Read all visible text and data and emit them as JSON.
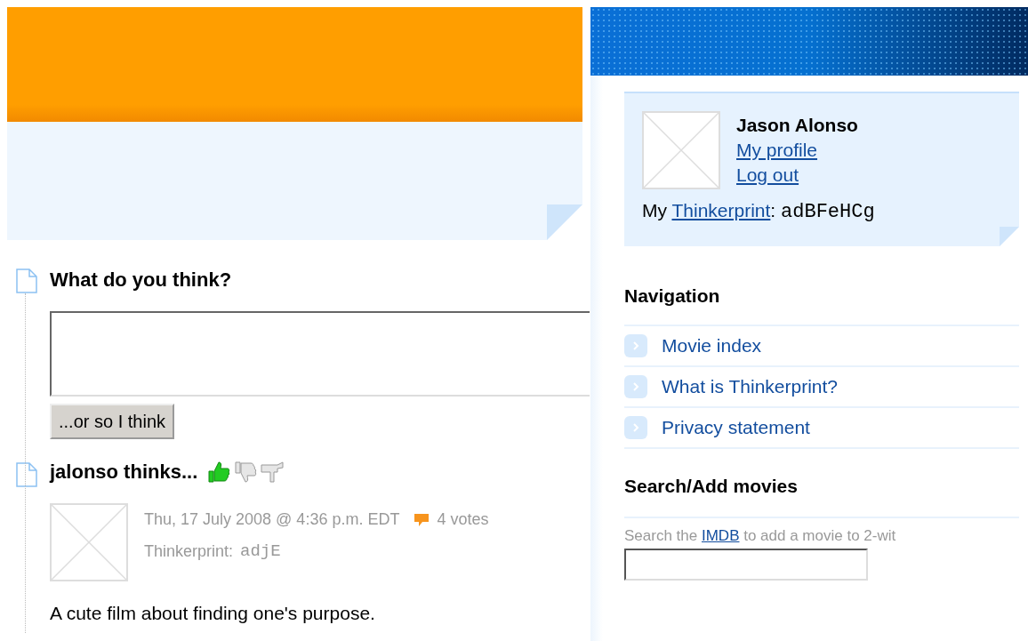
{
  "comment_form": {
    "heading": "What do you think?",
    "submit_button": "...or so I think"
  },
  "opinion": {
    "heading": "jalonso thinks...",
    "votes": [
      {
        "kind": "up",
        "selected": true
      },
      {
        "kind": "down",
        "selected": false
      },
      {
        "kind": "flag",
        "selected": false
      }
    ],
    "timestamp": "Thu, 17 July 2008 @ 4:36 p.m. EDT",
    "vote_count": "4 votes",
    "thinkerprint_label": "Thinkerprint:",
    "thinkerprint_code": "adjE",
    "text": "A cute film about finding one's purpose."
  },
  "user_panel": {
    "name": "Jason Alonso",
    "links": [
      "My profile",
      "Log out"
    ],
    "thinkerprint_prefix": "My",
    "thinkerprint_link": "Thinkerprint",
    "thinkerprint_suffix": ":",
    "thinkerprint_code": "adBFeHCg"
  },
  "navigation": {
    "heading": "Navigation",
    "items": [
      "Movie index",
      "What is Thinkerprint?",
      "Privacy statement"
    ]
  },
  "search": {
    "heading": "Search/Add movies",
    "hint_before": "Search the",
    "hint_link": "IMDB",
    "hint_after": "to add a movie to 2-wit"
  }
}
